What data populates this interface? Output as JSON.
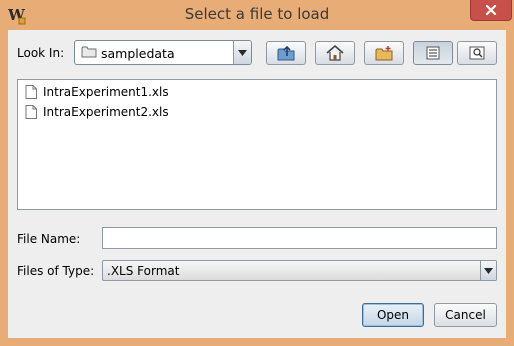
{
  "window": {
    "title": "Select a file to load",
    "app_icon": "w-app-icon",
    "close_icon": "close-icon"
  },
  "toolbar": {
    "look_in_label": "Look In:",
    "look_in_value": "sampledata",
    "buttons": [
      {
        "name": "up-one-level-button",
        "icon": "folder-up-icon"
      },
      {
        "name": "home-button",
        "icon": "home-icon"
      },
      {
        "name": "new-folder-button",
        "icon": "new-folder-icon"
      },
      {
        "name": "list-view-button",
        "icon": "list-icon",
        "selected": true
      },
      {
        "name": "details-view-button",
        "icon": "details-icon"
      }
    ]
  },
  "files": [
    {
      "name": "IntraExperiment1.xls",
      "icon": "document-icon"
    },
    {
      "name": "IntraExperiment2.xls",
      "icon": "document-icon"
    }
  ],
  "form": {
    "file_name_label": "File Name:",
    "file_name_value": "",
    "files_of_type_label": "Files of Type:",
    "files_of_type_value": ".XLS Format"
  },
  "actions": {
    "open_label": "Open",
    "cancel_label": "Cancel"
  },
  "colors": {
    "titlebar": "#e8ad76",
    "close_button": "#c7514a",
    "dialog_bg": "#eeeeee"
  }
}
